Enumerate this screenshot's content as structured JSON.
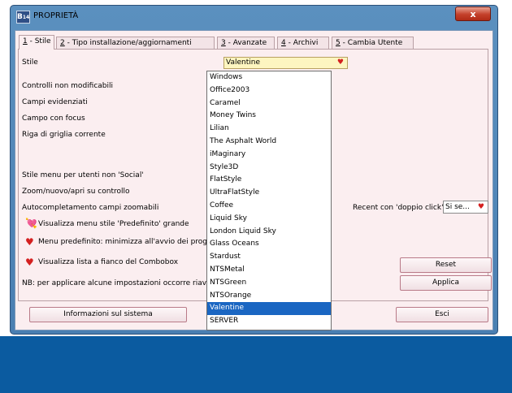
{
  "window": {
    "title": "PROPRIETÀ",
    "icon_text": "B",
    "icon_sub": "14",
    "close_label": "x"
  },
  "tabs": [
    {
      "key": "1",
      "label": " - Stile"
    },
    {
      "key": "2",
      "label": " - Tipo installazione/aggiornamenti"
    },
    {
      "key": "3",
      "label": " - Avanzate"
    },
    {
      "key": "4",
      "label": " - Archivi"
    },
    {
      "key": "5",
      "label": " - Cambia Utente"
    }
  ],
  "labels": {
    "stile": "Stile",
    "controlli": "Controlli non modificabili",
    "campi": "Campi evidenziati",
    "campo_focus": "Campo con focus",
    "riga": "Riga di griglia corrente",
    "menu_social": "Stile menu per utenti non 'Social'",
    "zoom": "Zoom/nuovo/apri su controllo",
    "autocompl": "Autocompletamento campi zoomabili",
    "recent": "Recent con 'doppio click'",
    "visualizza_menu": "Visualizza menu stile 'Predefinito' grande",
    "menu_pred": "Menu predefinito: minimizza all'avvio dei progr",
    "visualizza_lista": "Visualizza lista a fianco del Combobox",
    "nb": "NB: per applicare alcune impostazioni occorre riavv"
  },
  "style_combo": {
    "value": "Valentine",
    "heart": "♥"
  },
  "recent_combo": {
    "value": "Si se...",
    "heart": "♥"
  },
  "style_options": [
    "Windows",
    "Office2003",
    "Caramel",
    "Money Twins",
    "Lilian",
    "The Asphalt World",
    "iMaginary",
    "Style3D",
    "FlatStyle",
    "UltraFlatStyle",
    "Coffee",
    "Liquid Sky",
    "London Liquid Sky",
    "Glass Oceans",
    "Stardust",
    "NTSMetal",
    "NTSGreen",
    "NTSOrange",
    "Valentine",
    "SERVER"
  ],
  "selected_option": "Valentine",
  "buttons": {
    "reset": "Reset",
    "applica": "Applica",
    "info": "Informazioni sul sistema",
    "esci": "Esci"
  },
  "colors": {
    "accent": "#1a66c2",
    "heart": "#d42020",
    "panel": "#fbeef0",
    "taskbar": "#0b5ba0"
  }
}
